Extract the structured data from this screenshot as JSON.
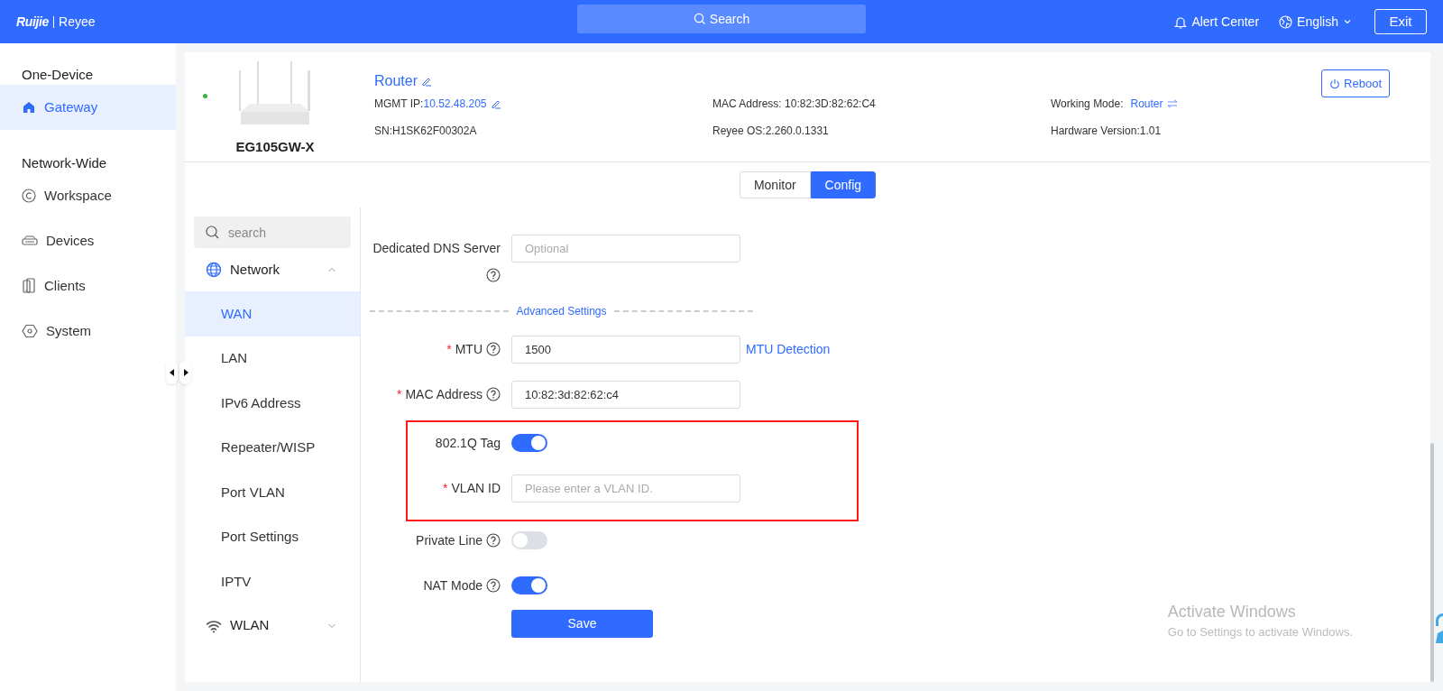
{
  "header": {
    "logo_brand": "Ruijie",
    "logo_product": "Reyee",
    "search": "Search",
    "alert": "Alert Center",
    "language": "English",
    "exit": "Exit"
  },
  "sidebar": [
    {
      "title": "One-Device",
      "items": [
        {
          "label": "Gateway",
          "selected": true
        }
      ]
    },
    {
      "title": "Network-Wide",
      "items": [
        {
          "label": "Workspace",
          "selected": false
        },
        {
          "label": "Devices",
          "selected": false
        },
        {
          "label": "Clients",
          "selected": false
        },
        {
          "label": "System",
          "selected": false
        }
      ]
    }
  ],
  "device": {
    "online": true,
    "model": "EG105GW-X",
    "name": "Router",
    "mgmt_ip_label": "MGMT IP:",
    "mgmt_ip": "10.52.48.205",
    "sn": "SN:H1SK62F00302A",
    "mac": "MAC Address: 10:82:3D:82:62:C4",
    "os": "Reyee OS:2.260.0.1331",
    "working_mode_label": "Working Mode:",
    "working_mode": "Router",
    "hardware": "Hardware Version:1.01",
    "reboot": "Reboot"
  },
  "tabs": [
    {
      "label": "Monitor",
      "selected": false
    },
    {
      "label": "Config",
      "selected": true
    }
  ],
  "submenu": {
    "search_placeholder": "search",
    "groups": [
      {
        "label": "Network",
        "expanded": true,
        "children": [
          {
            "label": "WAN",
            "selected": true
          },
          {
            "label": "LAN",
            "selected": false
          },
          {
            "label": "IPv6 Address",
            "selected": false
          },
          {
            "label": "Repeater/WISP",
            "selected": false
          },
          {
            "label": "Port VLAN",
            "selected": false
          },
          {
            "label": "Port Settings",
            "selected": false
          },
          {
            "label": "IPTV",
            "selected": false
          }
        ]
      },
      {
        "label": "WLAN",
        "expanded": false
      }
    ]
  },
  "form": [
    {
      "highlighted": false,
      "rows": [
        {
          "kind": "input",
          "label": "Dedicated DNS Server",
          "help": true,
          "placeholder": "Optional"
        },
        {
          "kind": "divider",
          "label": "Advanced Settings"
        },
        {
          "kind": "input",
          "label": "MTU",
          "required_mark": "*",
          "help": true,
          "value": "1500",
          "link": "MTU Detection"
        },
        {
          "kind": "input",
          "label": "MAC Address",
          "required_mark": "*",
          "help": true,
          "value": "10:82:3d:82:62:c4"
        }
      ]
    },
    {
      "highlighted": true,
      "rows": [
        {
          "kind": "toggle",
          "label": "802.1Q Tag",
          "help": false,
          "on": true
        },
        {
          "kind": "input",
          "label": "VLAN ID",
          "required_mark": "*",
          "help": false,
          "placeholder": "Please enter a VLAN ID."
        }
      ]
    },
    {
      "highlighted": false,
      "rows": [
        {
          "kind": "toggle",
          "label": "Private Line",
          "help": true,
          "on": false
        },
        {
          "kind": "toggle",
          "label": "NAT Mode",
          "help": true,
          "on": true
        },
        {
          "kind": "button",
          "label": "Save"
        }
      ]
    }
  ],
  "os_overlay": {
    "title": "Activate Windows",
    "subtitle": "Go to Settings to activate Windows."
  }
}
